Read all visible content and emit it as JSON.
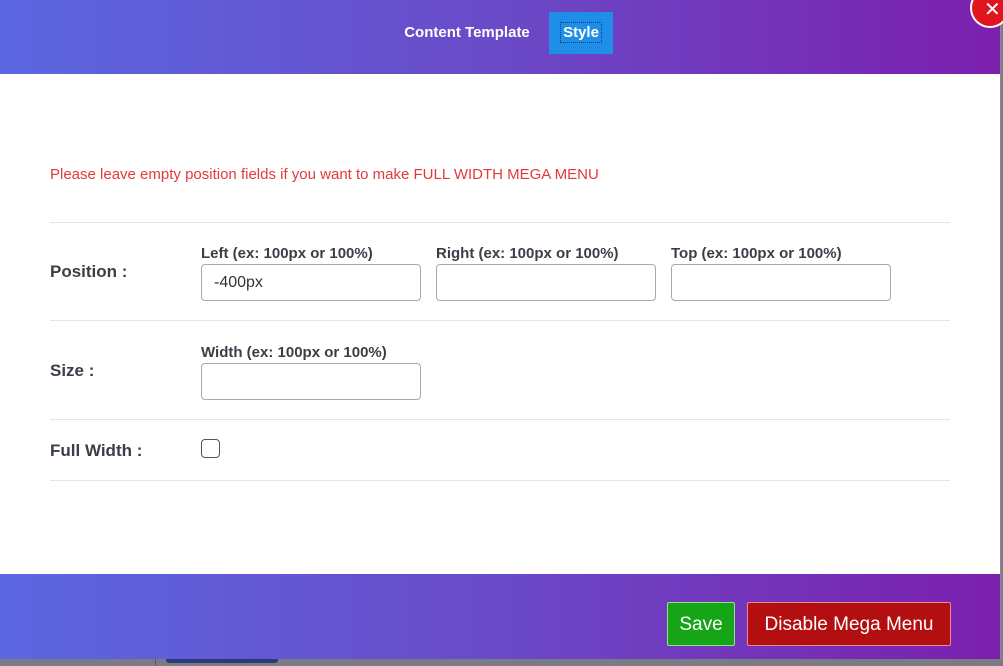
{
  "header": {
    "tabs": [
      {
        "label": "Content Template",
        "active": false
      },
      {
        "label": "Style",
        "active": true
      }
    ],
    "close_icon": "close-icon",
    "close_glyph": "✕"
  },
  "notice": "Please leave empty position fields if you want to make FULL WIDTH MEGA MENU",
  "position": {
    "label": "Position :",
    "left": {
      "label": "Left (ex: 100px or 100%)",
      "value": "-400px",
      "placeholder": ""
    },
    "right": {
      "label": "Right (ex: 100px or 100%)",
      "value": "",
      "placeholder": ""
    },
    "top": {
      "label": "Top (ex: 100px or 100%)",
      "value": "",
      "placeholder": ""
    }
  },
  "size": {
    "label": "Size :",
    "width": {
      "label": "Width (ex: 100px or 100%)",
      "value": "",
      "placeholder": ""
    }
  },
  "full_width": {
    "label": "Full Width :",
    "checked": false
  },
  "footer": {
    "save_label": "Save",
    "disable_label": "Disable Mega Menu"
  },
  "colors": {
    "gradient_start": "#5b67e1",
    "gradient_end": "#7c1fae",
    "active_tab": "#1e8ee8",
    "notice_text": "#e23a3a",
    "save_button": "#16a516",
    "disable_button": "#b30f10",
    "close_button": "#e0161f"
  }
}
